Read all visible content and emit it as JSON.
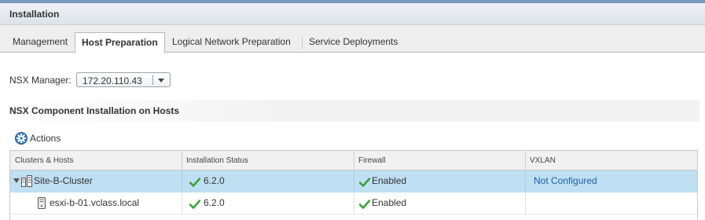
{
  "header": {
    "title": "Installation"
  },
  "tabs": [
    {
      "label": "Management",
      "active": false
    },
    {
      "label": "Host Preparation",
      "active": true
    },
    {
      "label": "Logical Network Preparation",
      "active": false
    },
    {
      "label": "Service Deployments",
      "active": false
    }
  ],
  "nsx_manager": {
    "label": "NSX Manager:",
    "selected": "172.20.110.43"
  },
  "section": {
    "title": "NSX Component Installation on Hosts"
  },
  "actions": {
    "label": "Actions",
    "icon": "gear-icon"
  },
  "grid": {
    "columns": [
      "Clusters & Hosts",
      "Installation Status",
      "Firewall",
      "VXLAN"
    ],
    "rows": [
      {
        "name": "Site-B-Cluster",
        "install": "6.2.0",
        "firewall": "Enabled",
        "vxlan": "Not Configured",
        "type": "cluster",
        "selected": true
      },
      {
        "name": "esxi-b-01.vclass.local",
        "install": "6.2.0",
        "firewall": "Enabled",
        "vxlan": "",
        "type": "host",
        "selected": false
      }
    ]
  },
  "colors": {
    "selected_row": "#bfdff3",
    "check_green": "#3aa535",
    "link_blue": "#1c5fa8"
  }
}
